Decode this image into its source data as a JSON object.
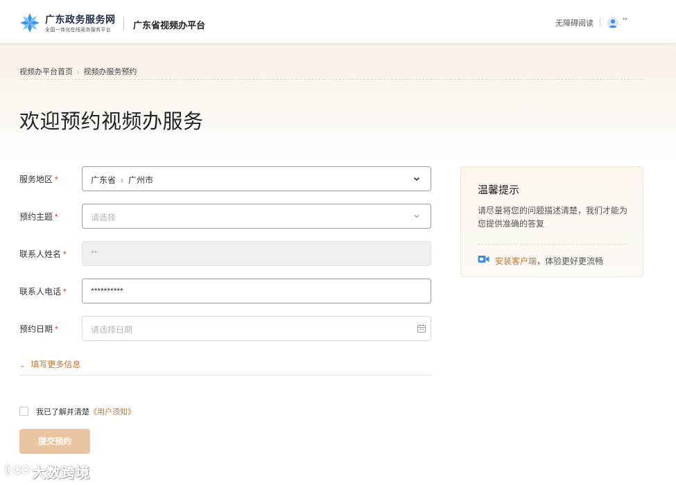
{
  "header": {
    "logo_title": "广东政务服务网",
    "logo_subtitle": "全国一体化在线政务服务平台",
    "platform_name": "广东省视频办平台",
    "accessibility_link": "无障碍阅读",
    "user_name": "**"
  },
  "breadcrumb": {
    "items": [
      "视频办平台首页",
      "视频办服务预约"
    ],
    "separator": "›"
  },
  "page_title": "欢迎预约视频办服务",
  "form": {
    "required_mark": "*",
    "region": {
      "label": "服务地区",
      "province": "广东省",
      "separator": "›",
      "city": "广州市"
    },
    "topic": {
      "label": "预约主题",
      "placeholder": "请选择"
    },
    "contact_name": {
      "label": "联系人姓名",
      "value": "**"
    },
    "contact_phone": {
      "label": "联系人电话",
      "value": "**********"
    },
    "date": {
      "label": "预约日期",
      "placeholder": "请选择日期"
    },
    "more_info": "填写更多信息",
    "agree_text": "我已了解并清楚",
    "agree_link": "《用户须知》",
    "submit_label": "提交预约"
  },
  "tips": {
    "title": "温馨提示",
    "body": "请尽量将您的问题描述清楚，我们才能为您提供准确的答复",
    "install_link": "安装客户端",
    "install_suffix": "，体验更好更流畅"
  },
  "watermark": "大数跨境",
  "colors": {
    "accent": "#b5793a",
    "required": "#d2343a",
    "submit_bg": "#e9c4a2",
    "logo_blue": "#3a8ee6"
  }
}
